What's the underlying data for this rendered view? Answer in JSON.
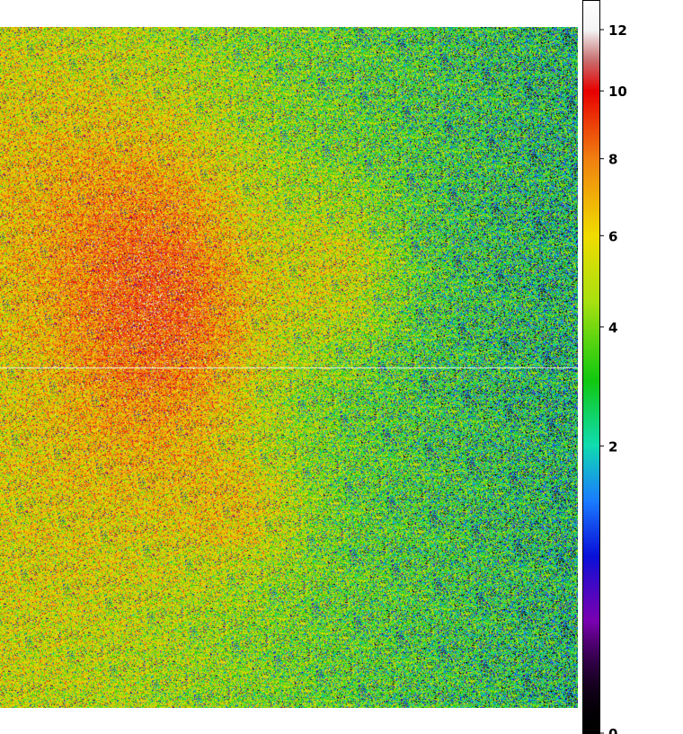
{
  "image": {
    "description_kind": "false-color intensity image with color scale",
    "colormap_stops": [
      {
        "value": 0,
        "color": "#000000"
      },
      {
        "value": 0.3,
        "color": "#7a00b0"
      },
      {
        "value": 0.75,
        "color": "#0a10d8"
      },
      {
        "value": 1.3,
        "color": "#1a7cff"
      },
      {
        "value": 2.0,
        "color": "#10dcb0"
      },
      {
        "value": 3.0,
        "color": "#10c810"
      },
      {
        "value": 4.5,
        "color": "#a8e010"
      },
      {
        "value": 6.0,
        "color": "#f0dc00"
      },
      {
        "value": 8.0,
        "color": "#f08010"
      },
      {
        "value": 10.0,
        "color": "#e80000"
      },
      {
        "value": 11.0,
        "color": "#c87070"
      },
      {
        "value": 12.0,
        "color": "#f4f4f4"
      },
      {
        "value": 13.0,
        "color": "#ffffff"
      }
    ]
  },
  "colorbar": {
    "ticks": [
      {
        "value": 12,
        "label": "12"
      },
      {
        "value": 10,
        "label": "10"
      },
      {
        "value": 8,
        "label": "8"
      },
      {
        "value": 6,
        "label": "6"
      },
      {
        "value": 4,
        "label": "4"
      },
      {
        "value": 2,
        "label": "2"
      },
      {
        "value": 0,
        "label": "0"
      }
    ],
    "min": 0,
    "max": 13,
    "scale": "sqrt"
  }
}
